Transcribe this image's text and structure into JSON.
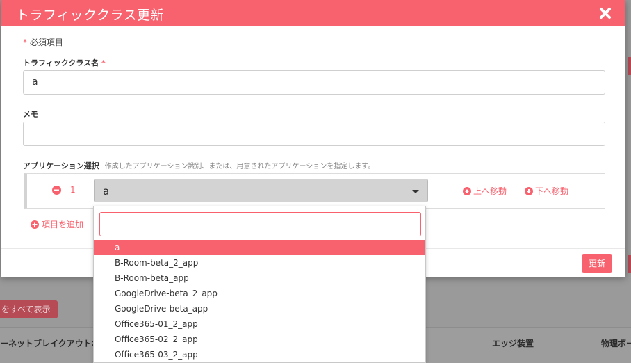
{
  "background": {
    "show_all_label": "をすべて表示",
    "table_headers": [
      "ーネットブレイクアウトポ",
      "エッジ装置",
      "物理ポー"
    ]
  },
  "modal": {
    "title": "トラフィッククラス更新",
    "required_note_mark": "*",
    "required_note_text": "必須項目",
    "name_label": "トラフィッククラス名",
    "name_required_mark": "*",
    "name_value": "a",
    "memo_label": "メモ",
    "memo_value": "",
    "app_label": "アプリケーション選択",
    "app_hint": "作成したアプリケーション識別、または、用意されたアプリケーションを指定します。",
    "app_rows": [
      {
        "index": "1",
        "selected": "a"
      }
    ],
    "move_up_label": "上へ移動",
    "move_down_label": "下へ移動",
    "add_item_label": "項目を追加",
    "update_button": "更新"
  },
  "dropdown": {
    "search_value": "",
    "options": [
      "a",
      "B-Room-beta_2_app",
      "B-Room-beta_app",
      "GoogleDrive-beta_2_app",
      "GoogleDrive-beta_app",
      "Office365-01_2_app",
      "Office365-02_2_app",
      "Office365-03_2_app"
    ],
    "selected_index": 0
  },
  "colors": {
    "accent": "#f8626e",
    "selected_bg": "#d3d3d3"
  }
}
